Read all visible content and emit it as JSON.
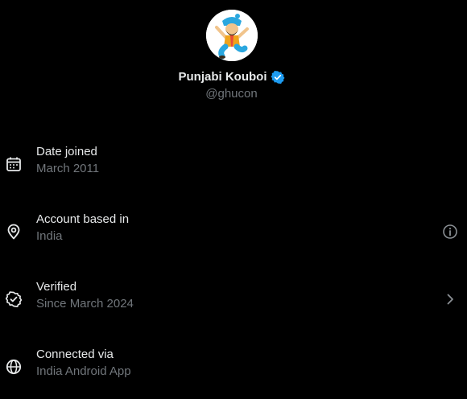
{
  "profile": {
    "display_name": "Punjabi Kouboi",
    "handle": "@ghucon",
    "verified_badge_color": "#1d9bf0"
  },
  "about": {
    "date_joined": {
      "title": "Date joined",
      "value": "March 2011",
      "icon": "calendar-icon"
    },
    "account_based_in": {
      "title": "Account based in",
      "value": "India",
      "icon": "location-pin-icon",
      "trailing_icon": "info-icon"
    },
    "verified": {
      "title": "Verified",
      "value": "Since March 2024",
      "icon": "verified-badge-outline-icon",
      "trailing_icon": "chevron-right-icon"
    },
    "connected_via": {
      "title": "Connected via",
      "value": "India Android App",
      "icon": "globe-icon"
    }
  },
  "colors": {
    "background": "#000000",
    "primary_text": "#e7e9ea",
    "secondary_text": "#71767b",
    "accent": "#1d9bf0"
  }
}
